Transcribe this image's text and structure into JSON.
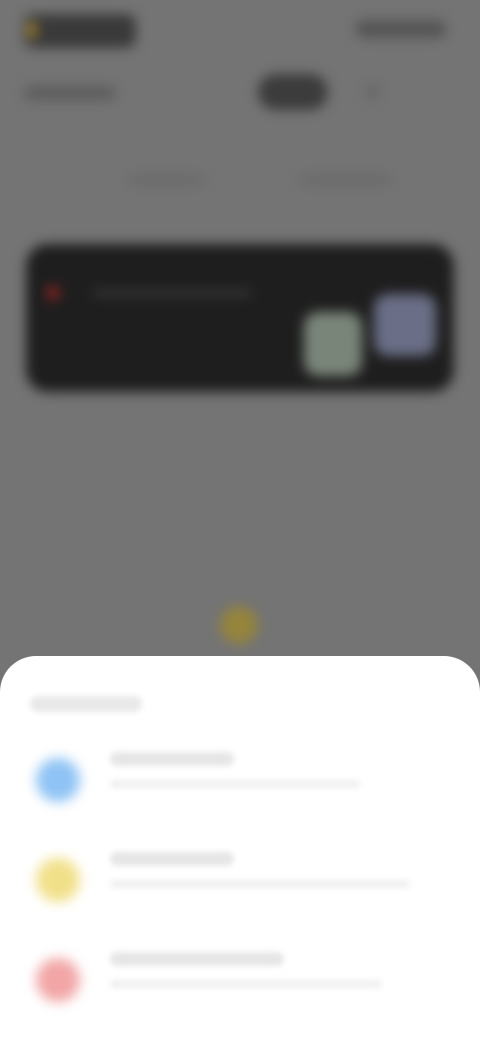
{
  "background_app": {
    "status_bar": {
      "time": "",
      "icons": [
        "signal-icon",
        "wifi-icon",
        "battery-icon"
      ]
    },
    "header": {
      "left_label": "",
      "center_pill": "",
      "action_icon": "more-icon"
    },
    "tabs": [
      "",
      ""
    ],
    "card": {
      "label": "",
      "thumbnails": [
        "",
        ""
      ]
    },
    "accent_color": "#b08a2a"
  },
  "sheet": {
    "title": "",
    "options": [
      {
        "title": "",
        "subtitle": "",
        "icon": "blue-circle-icon",
        "icon_color": "#8fc3f5"
      },
      {
        "title": "",
        "subtitle": "",
        "icon": "yellow-circle-icon",
        "icon_color": "#f1e08a"
      },
      {
        "title": "",
        "subtitle": "",
        "icon": "red-circle-icon",
        "icon_color": "#f2a6a6"
      }
    ]
  },
  "overlay": {
    "scrim_color": "#747474"
  }
}
